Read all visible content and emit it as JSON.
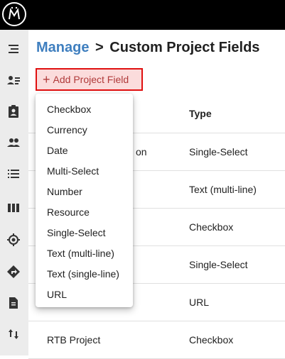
{
  "header": {
    "logo_icon": "maven-logo-icon"
  },
  "sidebar": {
    "icons": [
      "menu-collapse-icon",
      "contacts-list-icon",
      "clipboard-account-icon",
      "people-icon",
      "list-icon",
      "columns-icon",
      "crosshair-icon",
      "directions-icon",
      "document-icon",
      "sort-arrows-icon"
    ]
  },
  "breadcrumb": {
    "parent": "Manage",
    "separator": ">",
    "current": "Custom Project Fields"
  },
  "add_button": {
    "plus": "+",
    "label": "Add Project Field"
  },
  "table": {
    "type_header": "Type",
    "rows": [
      {
        "name": "on",
        "type": "Single-Select"
      },
      {
        "name": "",
        "type": "Text (multi-line)"
      },
      {
        "name": "",
        "type": "Checkbox"
      },
      {
        "name": "",
        "type": "Single-Select"
      },
      {
        "name": "",
        "type": "URL"
      },
      {
        "name": "RTB Project",
        "type": "Checkbox"
      }
    ]
  },
  "dropdown": {
    "items": [
      "Checkbox",
      "Currency",
      "Date",
      "Multi-Select",
      "Number",
      "Resource",
      "Single-Select",
      "Text (multi-line)",
      "Text (single-line)",
      "URL"
    ]
  }
}
